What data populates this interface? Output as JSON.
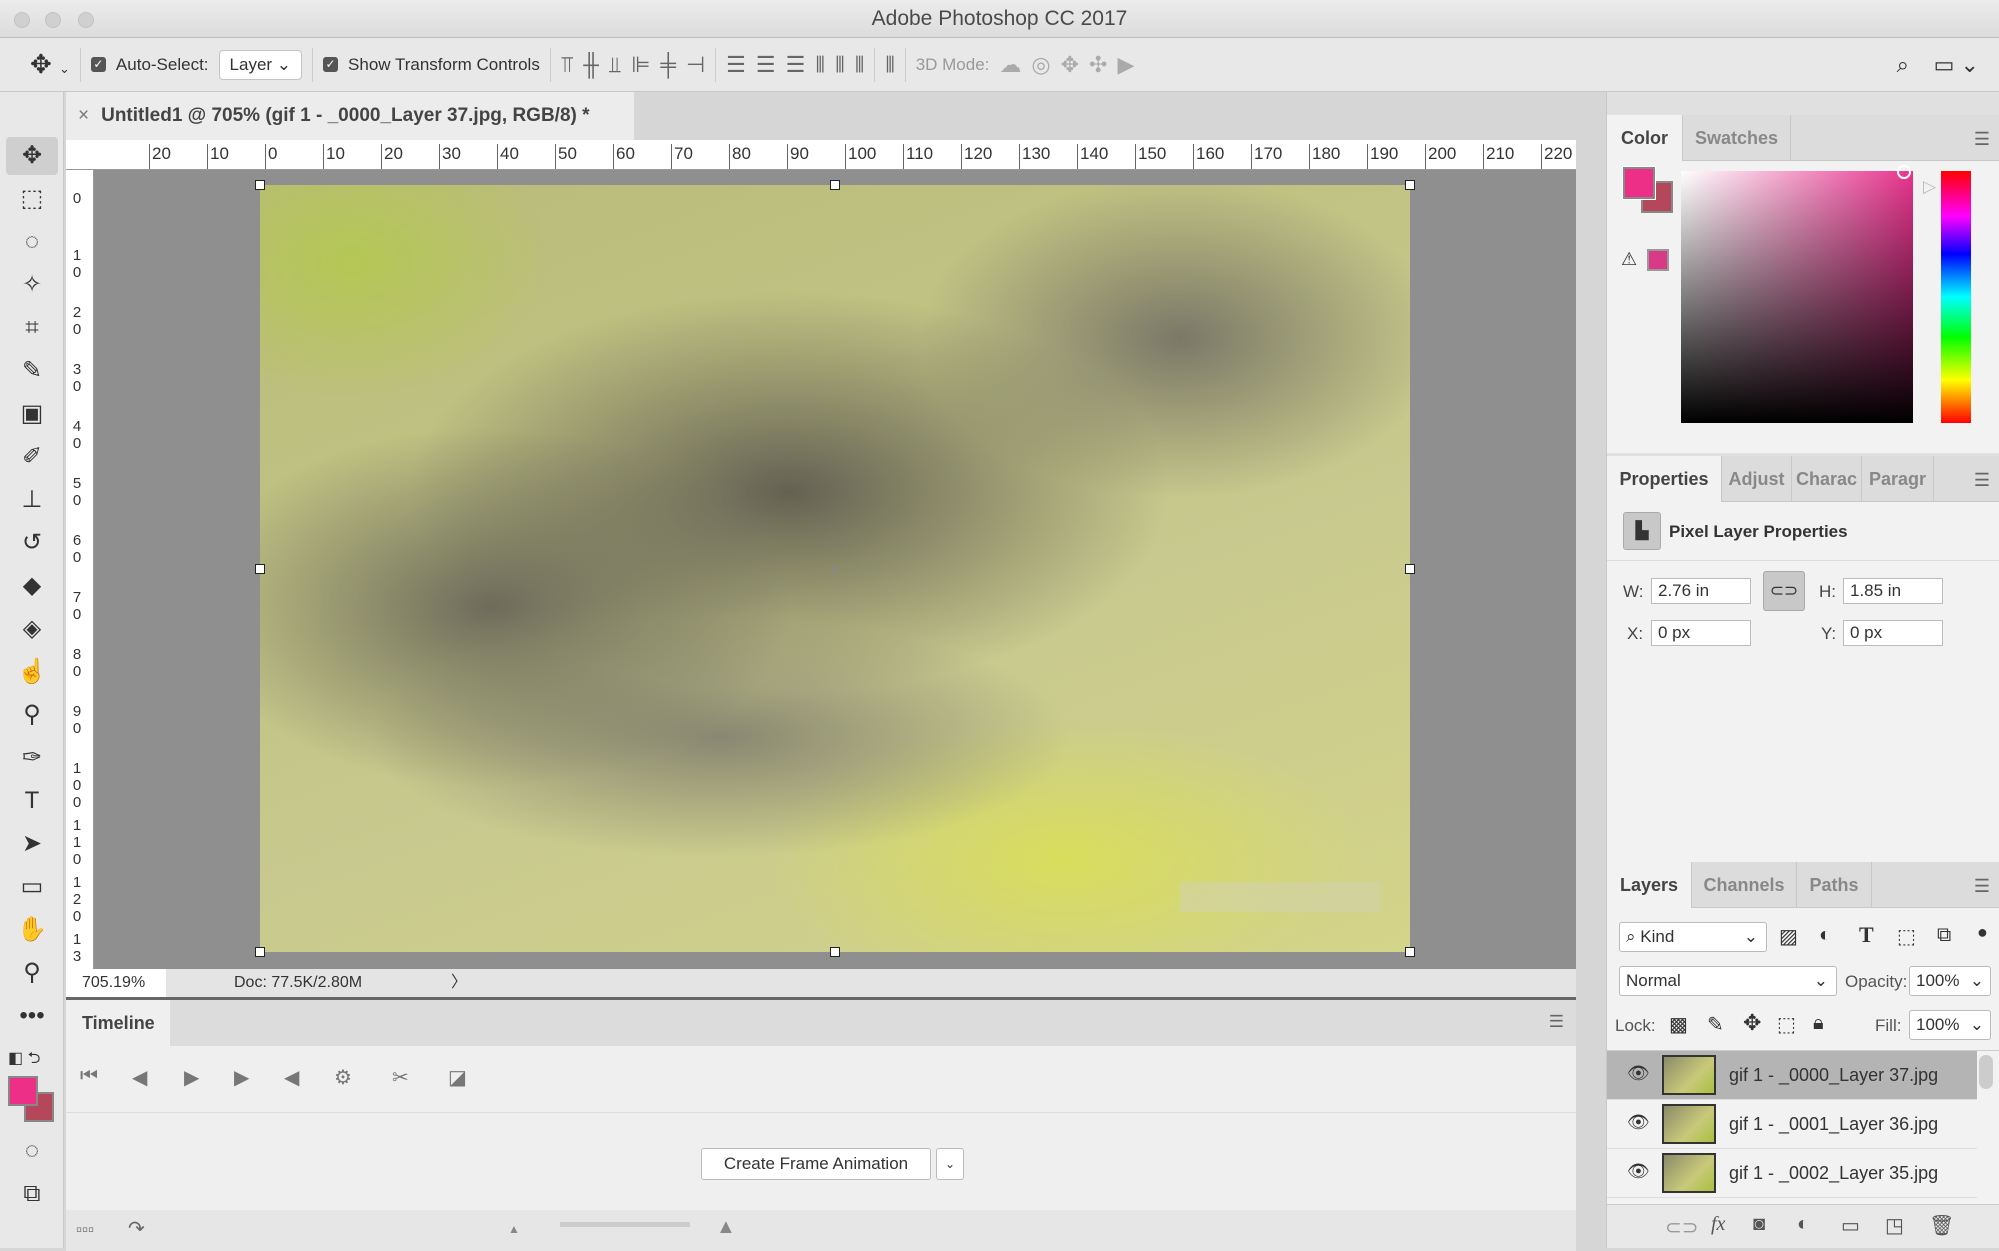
{
  "app_title": "Adobe Photoshop CC 2017",
  "options": {
    "auto_select_label": "Auto-Select:",
    "auto_select_checked": true,
    "auto_select_value": "Layer",
    "show_transform_label": "Show Transform Controls",
    "show_transform_checked": true,
    "mode_3d_label": "3D Mode:"
  },
  "document": {
    "tab_title": "Untitled1 @ 705% (gif 1 - _0000_Layer 37.jpg, RGB/8) *",
    "zoom": "705.19%",
    "doc_info": "Doc: 77.5K/2.80M"
  },
  "rulers": {
    "horizontal": [
      "20",
      "10",
      "0",
      "10",
      "20",
      "30",
      "40",
      "50",
      "60",
      "70",
      "80",
      "90",
      "100",
      "110",
      "120",
      "130",
      "140",
      "150",
      "160",
      "170",
      "180",
      "190",
      "200",
      "210",
      "220"
    ],
    "vertical": [
      "0",
      "10",
      "20",
      "30",
      "40",
      "50",
      "60",
      "70",
      "80",
      "90",
      "100",
      "110",
      "120",
      "13"
    ]
  },
  "colors": {
    "foreground": "#ee2f87",
    "background": "#b5475a",
    "hue_accent": "#e8338e"
  },
  "color_panel": {
    "tabs": [
      "Color",
      "Swatches"
    ],
    "active": "Color"
  },
  "properties_panel": {
    "tabs": [
      "Properties",
      "Adjust",
      "Charac",
      "Paragr"
    ],
    "active": "Properties",
    "title": "Pixel Layer Properties",
    "w_label": "W:",
    "w_value": "2.76 in",
    "h_label": "H:",
    "h_value": "1.85 in",
    "x_label": "X:",
    "x_value": "0 px",
    "y_label": "Y:",
    "y_value": "0 px"
  },
  "layers_panel": {
    "tabs": [
      "Layers",
      "Channels",
      "Paths"
    ],
    "active": "Layers",
    "filter": "Kind",
    "blend_mode": "Normal",
    "opacity_label": "Opacity:",
    "opacity": "100%",
    "lock_label": "Lock:",
    "fill_label": "Fill:",
    "fill": "100%",
    "layers": [
      {
        "name": "gif 1 - _0000_Layer 37.jpg",
        "selected": true,
        "visible": true
      },
      {
        "name": "gif 1 - _0001_Layer 36.jpg",
        "selected": false,
        "visible": true
      },
      {
        "name": "gif 1 - _0002_Layer 35.jpg",
        "selected": false,
        "visible": true
      }
    ]
  },
  "timeline": {
    "tab": "Timeline",
    "create_button": "Create Frame Animation"
  }
}
